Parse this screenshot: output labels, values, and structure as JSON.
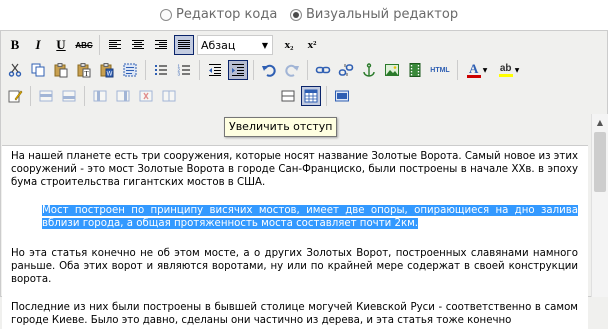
{
  "mode": {
    "code_label": "Редактор кода",
    "visual_label": "Визуальный редактор",
    "selected": "visual"
  },
  "toolbar": {
    "bold": "B",
    "italic": "I",
    "underline": "U",
    "strike": "ABC",
    "format_select": "Абзац",
    "subscript": "x₂",
    "superscript": "x²",
    "html_label": "HTML",
    "font_color_letter": "A",
    "bg_color_letter": "ab"
  },
  "tooltip": "Увеличить отступ",
  "colors": {
    "accent": "#3399ff",
    "icon_blue": "#2f5fb3",
    "font_color": "#cc0000",
    "bg_color": "#ffff00"
  },
  "content": {
    "p1": "На нашей планете есть три сооружения, которые носят название Золотые Ворота. Самый новое из этих сооружений - это мост Золотые Ворота в городе Сан-Франциско, были построены в начале XXв. в эпоху бума строительства гигантских мостов в США.",
    "p2": "Мост построен по принципу висячих мостов, имеет две опоры, опирающиеся на дно залива вблизи города, а общая протяженность моста составляет почти 2км.",
    "p3": "Но эта статья конечно не об этом мосте, а о других Золотых Ворот, построенных славянами намного раньше. Оба этих ворот и являются воротами, ну или по крайней мере содержат в своей конструкции ворота.",
    "p4": "Последние из них были построены в бывшей столице могучей Киевской Руси - соответственно в самом городе Киеве. Было это давно, сделаны они частично из дерева, и эта статья тоже конечно"
  }
}
